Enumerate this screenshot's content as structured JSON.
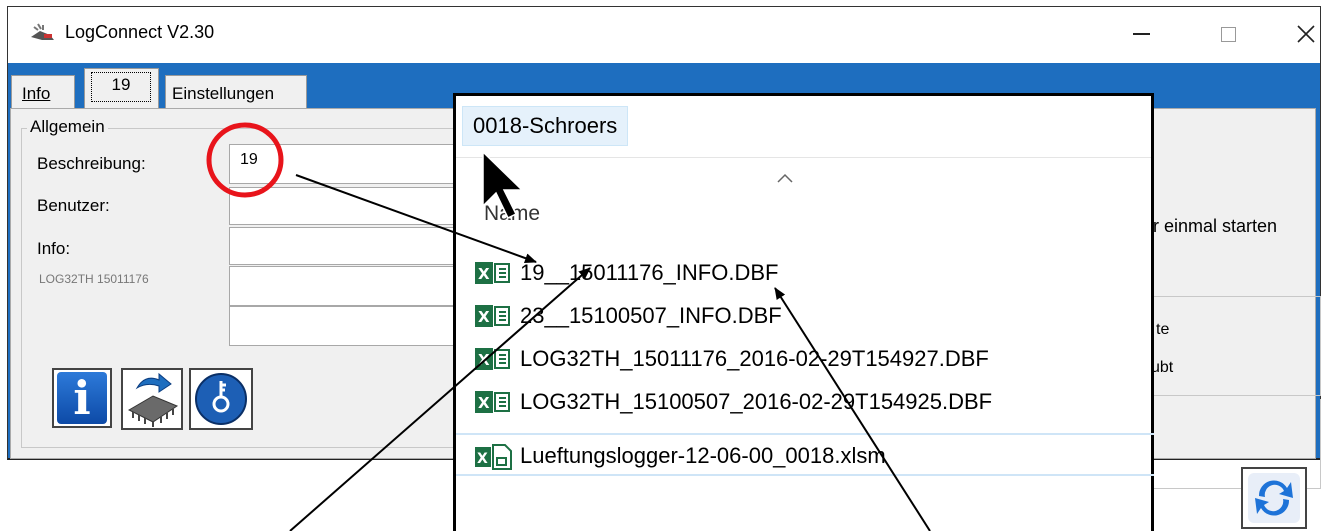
{
  "window": {
    "title": "LogConnect V2.30",
    "controls": {
      "minimize": "–",
      "maximize": "□",
      "close": "✕"
    }
  },
  "tabs": [
    {
      "label": "Info"
    },
    {
      "label": "19"
    },
    {
      "label": "Einstellungen"
    }
  ],
  "general": {
    "group_title": "Allgemein",
    "description_label": "Beschreibung:",
    "description_value": "19",
    "user_label": "Benutzer:",
    "user_value": "",
    "info_label": "Info:",
    "device_text": "LOG32TH 15011176"
  },
  "right_panel": {
    "text1": "r einmal starten",
    "text2": "te",
    "text3": "ubt"
  },
  "explorer": {
    "folder": "0018-Schroers",
    "column": "Name",
    "files": [
      {
        "name": "19__15011176_INFO.DBF",
        "icon": "excel-icon"
      },
      {
        "name": "23__15100507_INFO.DBF",
        "icon": "excel-icon"
      },
      {
        "name": "LOG32TH_15011176_2016-02-29T154927.DBF",
        "icon": "excel-icon"
      },
      {
        "name": "LOG32TH_15100507_2016-02-29T154925.DBF",
        "icon": "excel-icon"
      },
      {
        "name": "Lueftungslogger-12-06-00_0018.xlsm",
        "icon": "excel-macro-icon"
      }
    ]
  },
  "colors": {
    "accent": "#1e6ebf",
    "excel": "#1d7044",
    "annotation_circle": "#e8141b"
  }
}
